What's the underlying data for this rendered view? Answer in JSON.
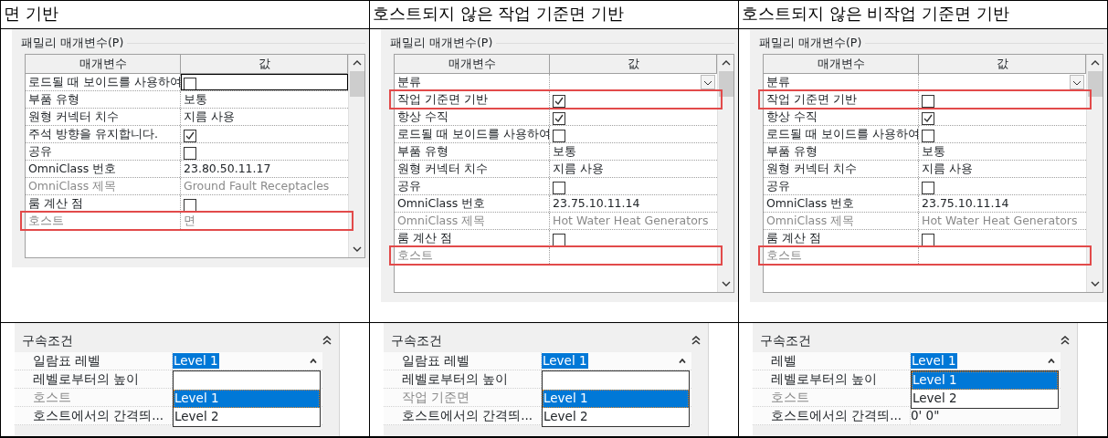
{
  "columns": [
    {
      "title": "면 기반",
      "parameters": {
        "group_title": "패밀리 매개변수(P)",
        "headers": [
          "매개변수",
          "값"
        ],
        "rows": [
          {
            "name": "로드될 때 보이드를 사용하여",
            "kind": "check",
            "checked": false,
            "focused": true
          },
          {
            "name": "부품 유형",
            "kind": "text",
            "value": "보통"
          },
          {
            "name": "원형 커넥터 치수",
            "kind": "text",
            "value": "지름 사용"
          },
          {
            "name": "주석 방향을 유지합니다.",
            "kind": "check",
            "checked": true
          },
          {
            "name": "공유",
            "kind": "check",
            "checked": false
          },
          {
            "name": "OmniClass 번호",
            "kind": "text",
            "value": "23.80.50.11.17"
          },
          {
            "name": "OmniClass 제목",
            "kind": "text",
            "value": "Ground Fault Receptacles",
            "disabled": true
          },
          {
            "name": "룸 계산 점",
            "kind": "check",
            "checked": false
          },
          {
            "name": "호스트",
            "kind": "text",
            "value": "면",
            "disabled": true,
            "highlighted": true
          }
        ]
      },
      "constraints": {
        "title": "구속조건",
        "rows": [
          {
            "label": "일람표 레벨",
            "kind": "select",
            "value": "Level 1"
          },
          {
            "label": "레벨로부터의 높이"
          },
          {
            "label": "호스트",
            "disabled": true
          },
          {
            "label": "호스트에서의 간격띄..."
          }
        ],
        "dropdown": {
          "blank_option": true,
          "options": [
            {
              "label": "Level 1",
              "selected": true
            },
            {
              "label": "Level 2",
              "selected": false
            }
          ]
        }
      }
    },
    {
      "title": "호스트되지 않은 작업 기준면 기반",
      "parameters": {
        "group_title": "패밀리 매개변수(P)",
        "headers": [
          "매개변수",
          "값"
        ],
        "rows": [
          {
            "name": "분류",
            "kind": "dropdown"
          },
          {
            "name": "작업 기준면 기반",
            "kind": "check",
            "checked": true,
            "highlighted": true
          },
          {
            "name": "항상 수직",
            "kind": "check",
            "checked": true
          },
          {
            "name": "로드될 때 보이드를 사용하여",
            "kind": "check",
            "checked": false
          },
          {
            "name": "부품 유형",
            "kind": "text",
            "value": "보통"
          },
          {
            "name": "원형 커넥터 치수",
            "kind": "text",
            "value": "지름 사용"
          },
          {
            "name": "공유",
            "kind": "check",
            "checked": false
          },
          {
            "name": "OmniClass 번호",
            "kind": "text",
            "value": "23.75.10.11.14"
          },
          {
            "name": "OmniClass 제목",
            "kind": "text",
            "value": "Hot Water Heat Generators",
            "disabled": true
          },
          {
            "name": "룸 계산 점",
            "kind": "check",
            "checked": false
          },
          {
            "name": "호스트",
            "kind": "text",
            "disabled": true,
            "highlighted": true
          }
        ]
      },
      "constraints": {
        "title": "구속조건",
        "rows": [
          {
            "label": "일람표 레벨",
            "kind": "select",
            "value": "Level 1"
          },
          {
            "label": "레벨로부터의 높이"
          },
          {
            "label": "작업 기준면",
            "disabled": true
          },
          {
            "label": "호스트에서의 간격띄..."
          }
        ],
        "dropdown": {
          "blank_option": true,
          "options": [
            {
              "label": "Level 1",
              "selected": true
            },
            {
              "label": "Level 2",
              "selected": false
            }
          ]
        }
      }
    },
    {
      "title": "호스트되지 않은 비작업 기준면 기반",
      "parameters": {
        "group_title": "패밀리 매개변수(P)",
        "headers": [
          "매개변수",
          "값"
        ],
        "rows": [
          {
            "name": "분류",
            "kind": "dropdown"
          },
          {
            "name": "작업 기준면 기반",
            "kind": "check",
            "checked": false,
            "highlighted": true
          },
          {
            "name": "항상 수직",
            "kind": "check",
            "checked": true
          },
          {
            "name": "로드될 때 보이드를 사용하여",
            "kind": "check",
            "checked": false
          },
          {
            "name": "부품 유형",
            "kind": "text",
            "value": "보통"
          },
          {
            "name": "원형 커넥터 치수",
            "kind": "text",
            "value": "지름 사용"
          },
          {
            "name": "공유",
            "kind": "check",
            "checked": false
          },
          {
            "name": "OmniClass 번호",
            "kind": "text",
            "value": "23.75.10.11.14"
          },
          {
            "name": "OmniClass 제목",
            "kind": "text",
            "value": "Hot Water Heat Generators",
            "disabled": true
          },
          {
            "name": "룸 계산 점",
            "kind": "check",
            "checked": false
          },
          {
            "name": "호스트",
            "kind": "text",
            "disabled": true,
            "highlighted": true
          }
        ]
      },
      "constraints": {
        "title": "구속조건",
        "rows": [
          {
            "label": "레벨",
            "kind": "select",
            "value": "Level 1"
          },
          {
            "label": "레벨로부터의 높이"
          },
          {
            "label": "호스트",
            "disabled": true
          },
          {
            "label": "호스트에서의 간격띄...",
            "value": "0'  0\""
          }
        ],
        "dropdown": {
          "options": [
            {
              "label": "Level 1",
              "selected": true
            },
            {
              "label": "Level 2",
              "selected": false
            }
          ]
        }
      }
    }
  ]
}
